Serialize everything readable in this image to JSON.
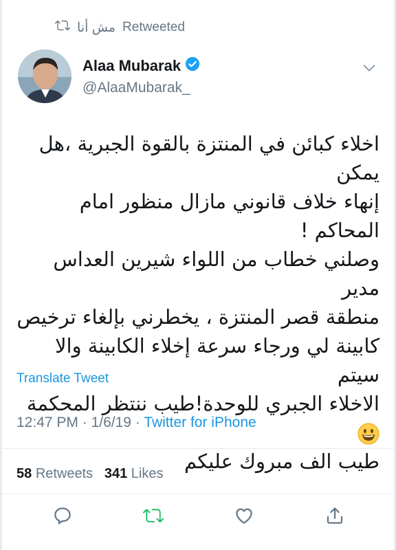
{
  "retweet_banner": {
    "user": "مش أنا",
    "label": "Retweeted"
  },
  "author": {
    "display_name": "Alaa Mubarak",
    "handle": "@AlaaMubarak_",
    "verified": true
  },
  "tweet": {
    "lines": [
      "اخلاء كبائن في المنتزة بالقوة الجبرية ،هل يمكن",
      "إنهاء خلاف قانوني مازال منظور امام المحاكم !",
      "وصلني خطاب من اللواء شيرين العداس مدير",
      "منطقة قصر المنتزة ، يخطرني بإلغاء ترخيص",
      "كابينة لي ورجاء سرعة إخلاء الكابينة والا سيتم",
      "الاخلاء الجبري للوحدة!طيب ننتظر المحكمة",
      "طيب الف مبروك عليكم"
    ],
    "translate_label": "Translate Tweet",
    "time": "12:47 PM",
    "date": "1/6/19",
    "separator": "·",
    "source": "Twitter for iPhone"
  },
  "stats": {
    "retweets_count": "58",
    "retweets_label": "Retweets",
    "likes_count": "341",
    "likes_label": "Likes"
  },
  "colors": {
    "link": "#1b95e0",
    "muted": "#657786",
    "retweet_active": "#17bf63",
    "verified": "#1da1f2"
  },
  "icons": [
    "retweet-icon",
    "verified-badge-icon",
    "chevron-down-icon",
    "reply-icon",
    "retweet-action-icon",
    "like-icon",
    "share-icon",
    "grinning-face-emoji"
  ]
}
